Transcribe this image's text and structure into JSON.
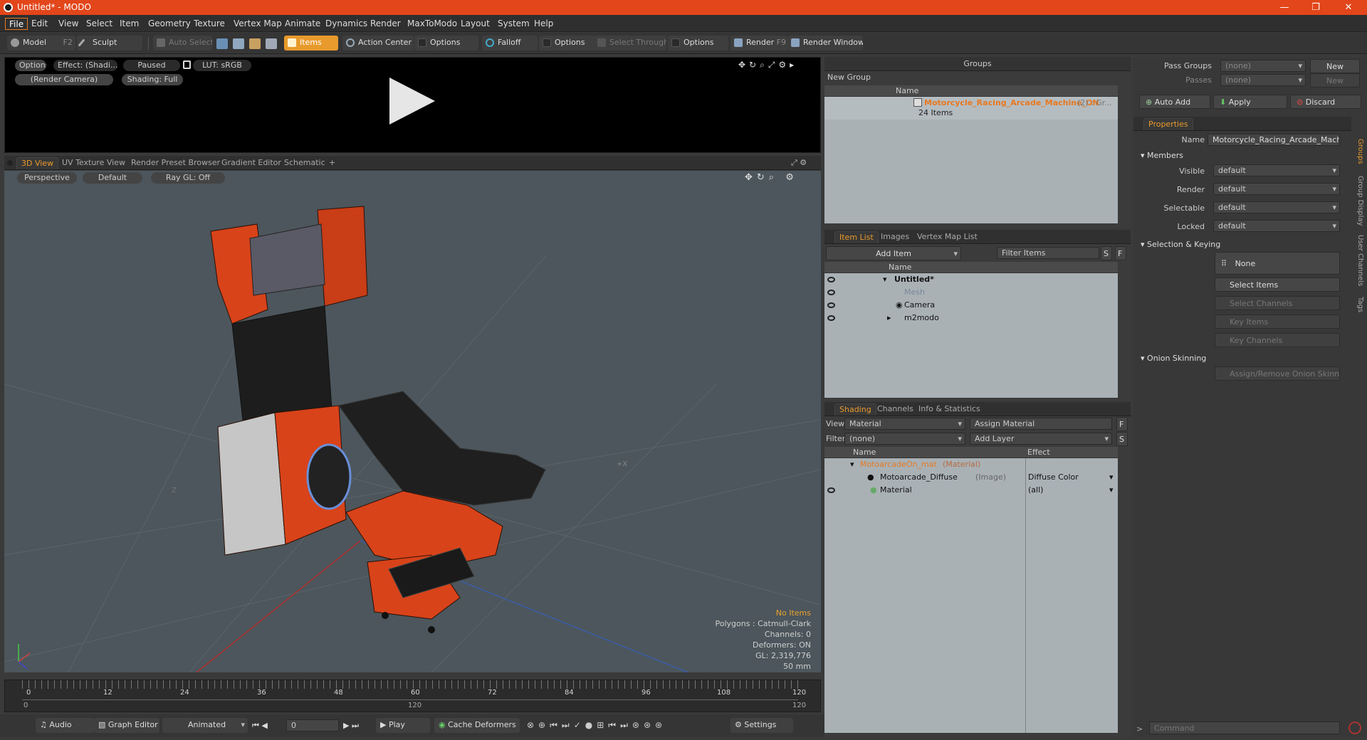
{
  "window": {
    "title": "Untitled* - MODO",
    "minimize": "—",
    "maximize": "❐",
    "close": "✕"
  },
  "menu": [
    "File",
    "Edit",
    "View",
    "Select",
    "Item",
    "Geometry",
    "Texture",
    "Vertex Map",
    "Animate",
    "Dynamics",
    "Render",
    "MaxToModo",
    "Layout",
    "System",
    "Help"
  ],
  "toolbar": {
    "model": "Model",
    "model_key": "F2",
    "sculpt": "Sculpt",
    "auto_select": "Auto Select",
    "items": "Items",
    "action_center": "Action Center",
    "options1": "Options",
    "falloff": "Falloff",
    "options2": "Options",
    "select_through": "Select Through",
    "options3": "Options",
    "render": "Render",
    "render_key": "F9",
    "render_window": "Render Window"
  },
  "preview": {
    "options": "Options",
    "effect": "Effect: (Shadi...",
    "paused": "Paused",
    "lut": "LUT: sRGB",
    "camera": "(Render Camera)",
    "shading": "Shading: Full"
  },
  "view_tabs": {
    "tabs": [
      "3D View",
      "UV Texture View",
      "Render Preset Browser",
      "Gradient Editor",
      "Schematic"
    ],
    "add": "+"
  },
  "viewport": {
    "perspective": "Perspective",
    "default": "Default",
    "raygl": "Ray GL: Off",
    "hud": {
      "no_items": "No Items",
      "polygons": "Polygons : Catmull-Clark",
      "channels": "Channels: 0",
      "deformers": "Deformers: ON",
      "gl": "GL: 2,319,776",
      "scale": "50 mm"
    },
    "axis_z": "Z",
    "axis_x": "+X"
  },
  "timeline": {
    "ticks": [
      "0",
      "12",
      "24",
      "36",
      "48",
      "60",
      "72",
      "84",
      "96",
      "108",
      "120"
    ],
    "lower": [
      "0",
      "120",
      "120"
    ]
  },
  "bottombar": {
    "audio": "Audio",
    "graph_editor": "Graph Editor",
    "animated": "Animated",
    "frame": "0",
    "play": "Play",
    "cache_deformers": "Cache Deformers",
    "settings": "Settings"
  },
  "groups": {
    "header": "Groups",
    "new_group": "New Group",
    "col_name": "Name",
    "group_name": "Motorcycle_Racing_Arcade_Machine_ON",
    "group_suffix": "(2) : Gr...",
    "group_count": "24 Items"
  },
  "item_list": {
    "tabs": [
      "Item List",
      "Images",
      "Vertex Map List"
    ],
    "add_item": "Add Item",
    "filter_items": "Filter Items",
    "s": "S",
    "f": "F",
    "col_name": "Name",
    "items": [
      {
        "name": "Untitled*",
        "indent": 0
      },
      {
        "name": "Mesh",
        "indent": 1
      },
      {
        "name": "Camera",
        "indent": 1
      },
      {
        "name": "m2modo",
        "indent": 1
      }
    ]
  },
  "shading": {
    "tabs": [
      "Shading",
      "Channels",
      "Info & Statistics"
    ],
    "view_label": "View",
    "view_value": "Material",
    "assign_material": "Assign Material",
    "filter_label": "Filter",
    "filter_value": "(none)",
    "add_layer": "Add Layer",
    "f": "F",
    "s": "S",
    "col_name": "Name",
    "col_effect": "Effect",
    "rows": [
      {
        "name": "MotoarcadeOn_mat",
        "tag": "(Material)",
        "effect": ""
      },
      {
        "name": "Motoarcade_Diffuse",
        "tag": "(Image)",
        "effect": "Diffuse Color"
      },
      {
        "name": "Material",
        "tag": "",
        "effect": "(all)"
      }
    ]
  },
  "pass": {
    "pass_groups": "Pass Groups",
    "passes": "Passes",
    "none1": "(none)",
    "none2": "(none)",
    "new1": "New",
    "new2": "New",
    "auto_add": "Auto Add",
    "apply": "Apply",
    "discard": "Discard"
  },
  "properties": {
    "tab": "Properties",
    "name_label": "Name",
    "name_value": "Motorcycle_Racing_Arcade_Machine_ON",
    "members": "Members",
    "fields": [
      {
        "label": "Visible",
        "value": "default"
      },
      {
        "label": "Render",
        "value": "default"
      },
      {
        "label": "Selectable",
        "value": "default"
      },
      {
        "label": "Locked",
        "value": "default"
      }
    ],
    "selection_keying": "Selection & Keying",
    "none": "None",
    "select_items": "Select Items",
    "select_channels": "Select Channels",
    "key_items": "Key Items",
    "key_channels": "Key Channels",
    "onion": "Onion Skinning",
    "assign_onion": "Assign/Remove Onion Skinning"
  },
  "side_tabs": [
    "Groups",
    "Group Display",
    "User Channels",
    "Tags"
  ],
  "command": {
    "placeholder": "Command"
  },
  "colors": {
    "accent": "#e89a2c",
    "title": "#e2461a",
    "mesh": "#e0451d"
  }
}
